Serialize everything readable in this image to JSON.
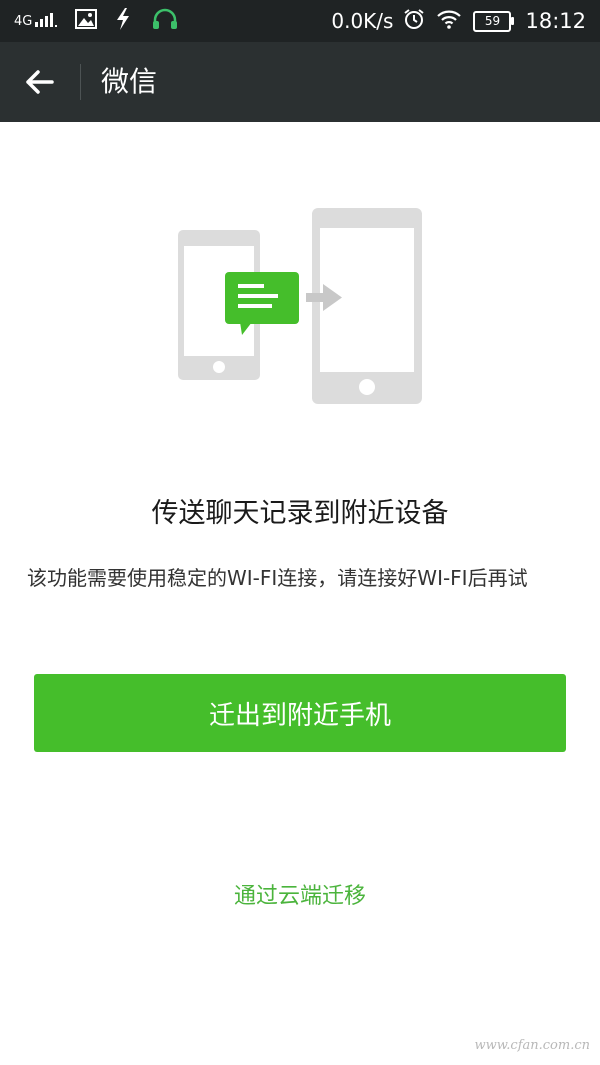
{
  "status_bar": {
    "network": "4G",
    "speed": "0.0K/s",
    "battery": "59",
    "time": "18:12",
    "icons": [
      "signal-icon",
      "image-icon",
      "bolt-icon",
      "headphones-icon",
      "alarm-icon",
      "wifi-icon",
      "battery-icon"
    ]
  },
  "header": {
    "back_icon": "arrow-left-icon",
    "title": "微信"
  },
  "main": {
    "heading": "传送聊天记录到附近设备",
    "description": "该功能需要使用稳定的WI-FI连接，请连接好WI-FI后再试",
    "primary_button": "迁出到附近手机",
    "cloud_link": "通过云端迁移"
  },
  "watermark": "www.cfan.com.cn",
  "colors": {
    "accent": "#45be2b",
    "link": "#4bb43c",
    "status_bar_bg": "#1f2324",
    "title_bar_bg": "#2b3031"
  }
}
